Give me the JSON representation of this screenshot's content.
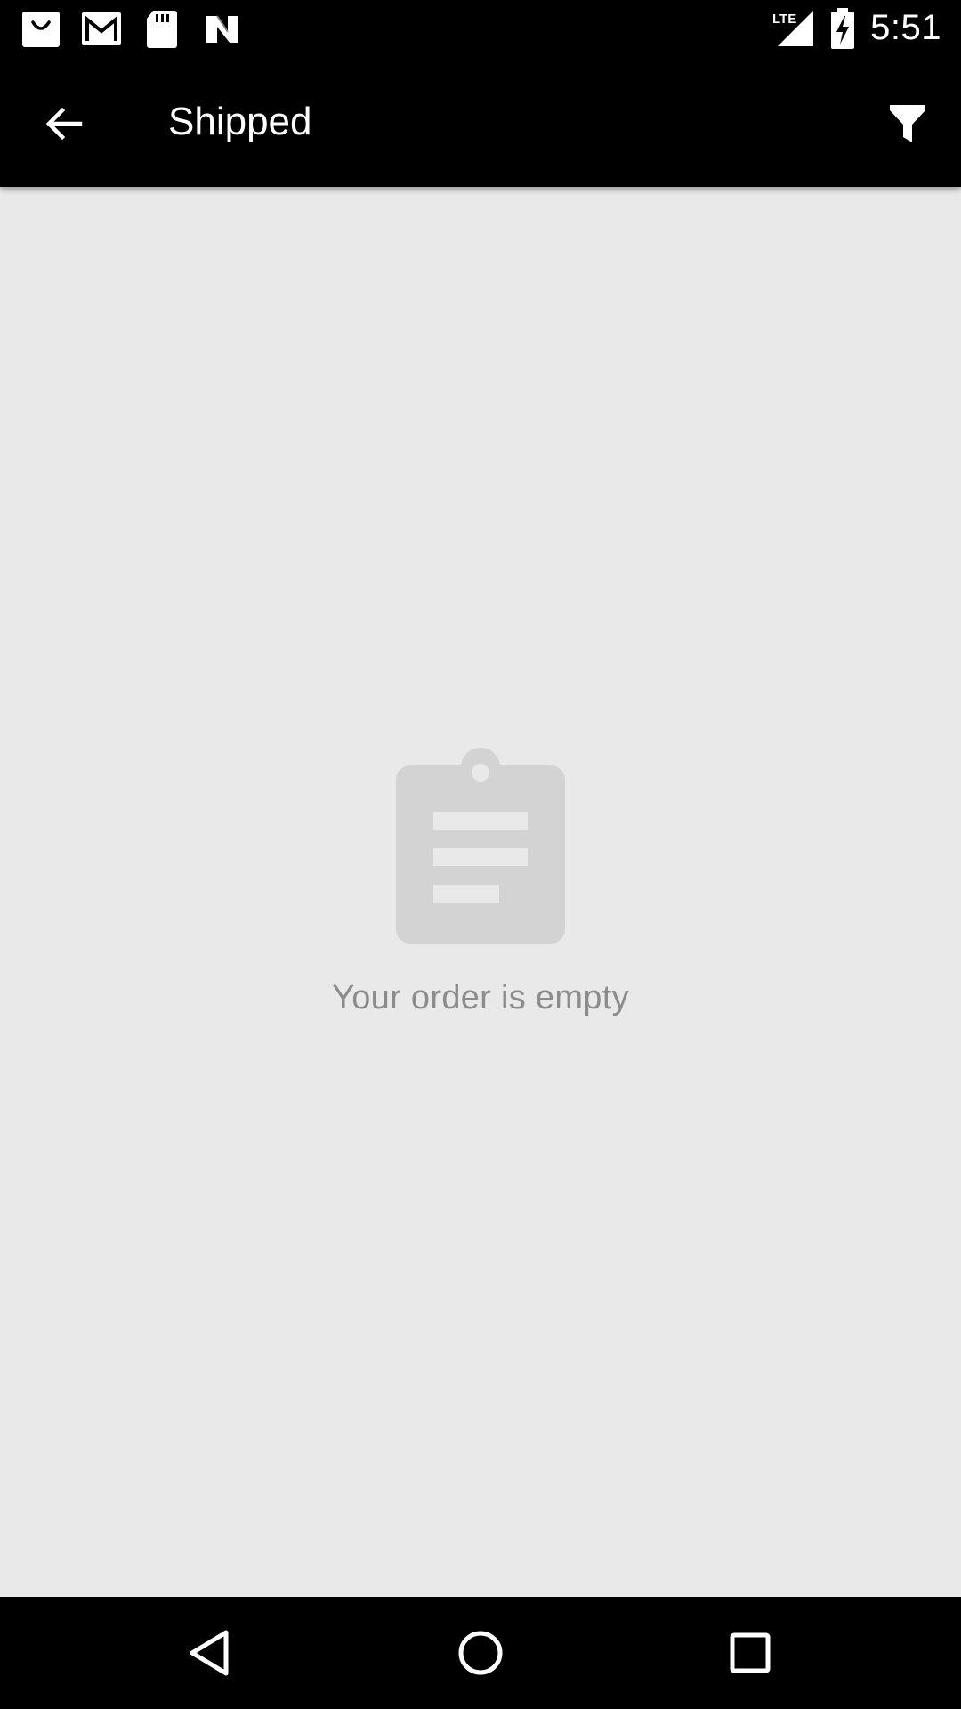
{
  "status_bar": {
    "time": "5:51",
    "network": "LTE",
    "icons": [
      "shopping-bag-icon",
      "gmail-icon",
      "sd-card-icon",
      "nfc-icon",
      "lte-signal-icon",
      "battery-charging-icon"
    ]
  },
  "app_bar": {
    "title": "Shipped",
    "back_icon": "arrow-back-icon",
    "filter_icon": "filter-icon"
  },
  "empty_state": {
    "icon": "clipboard-icon",
    "message": "Your order is empty"
  },
  "nav_bar": {
    "icons": [
      "nav-back-icon",
      "nav-home-icon",
      "nav-recents-icon"
    ]
  },
  "colors": {
    "bars": "#000000",
    "background": "#e9e9e9",
    "empty_icon": "#d3d3d3",
    "empty_text": "#8c8c8c"
  }
}
